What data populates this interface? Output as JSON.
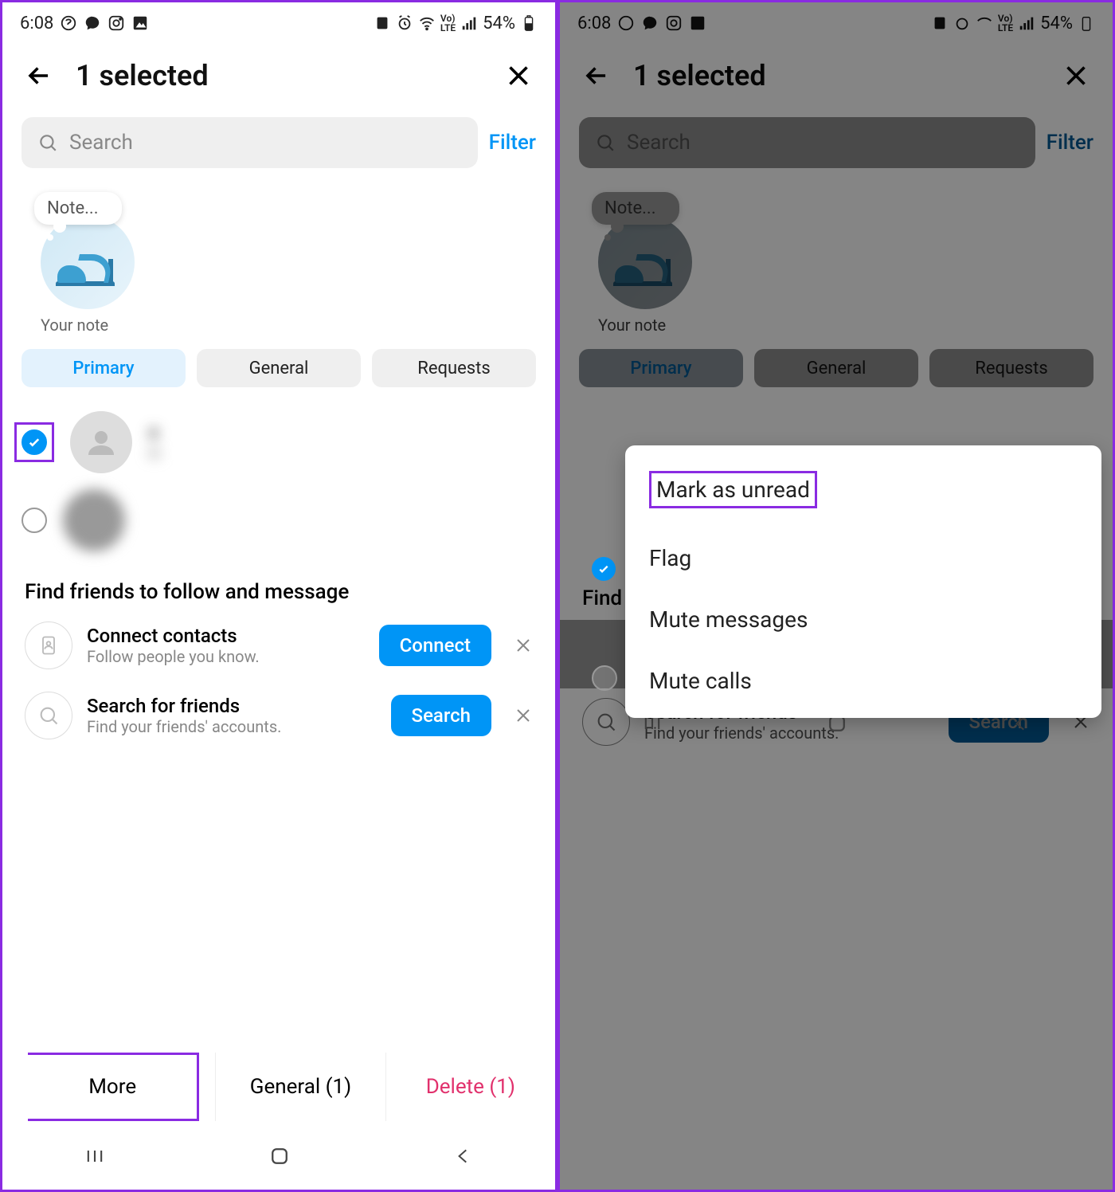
{
  "status": {
    "time": "6:08",
    "battery_pct": "54%"
  },
  "header": {
    "title": "1 selected"
  },
  "search": {
    "placeholder": "Search",
    "filter": "Filter"
  },
  "note": {
    "bubble": "Note...",
    "caption": "Your note"
  },
  "tabs": {
    "primary": "Primary",
    "general": "General",
    "requests": "Requests"
  },
  "chats": [
    {
      "name": "a",
      "msg": "H",
      "checked": true
    },
    {
      "name": " ",
      "msg": " ",
      "checked": false
    }
  ],
  "friends": {
    "title": "Find friends to follow and message",
    "connect": {
      "title": "Connect contacts",
      "sub": "Follow people you know.",
      "btn": "Connect"
    },
    "search": {
      "title": "Search for friends",
      "sub": "Find your friends' accounts.",
      "btn": "Search"
    }
  },
  "bottom": {
    "more": "More",
    "general": "General (1)",
    "delete": "Delete (1)"
  },
  "popup": [
    "Mark as unread",
    "Flag",
    "Mute messages",
    "Mute calls"
  ]
}
